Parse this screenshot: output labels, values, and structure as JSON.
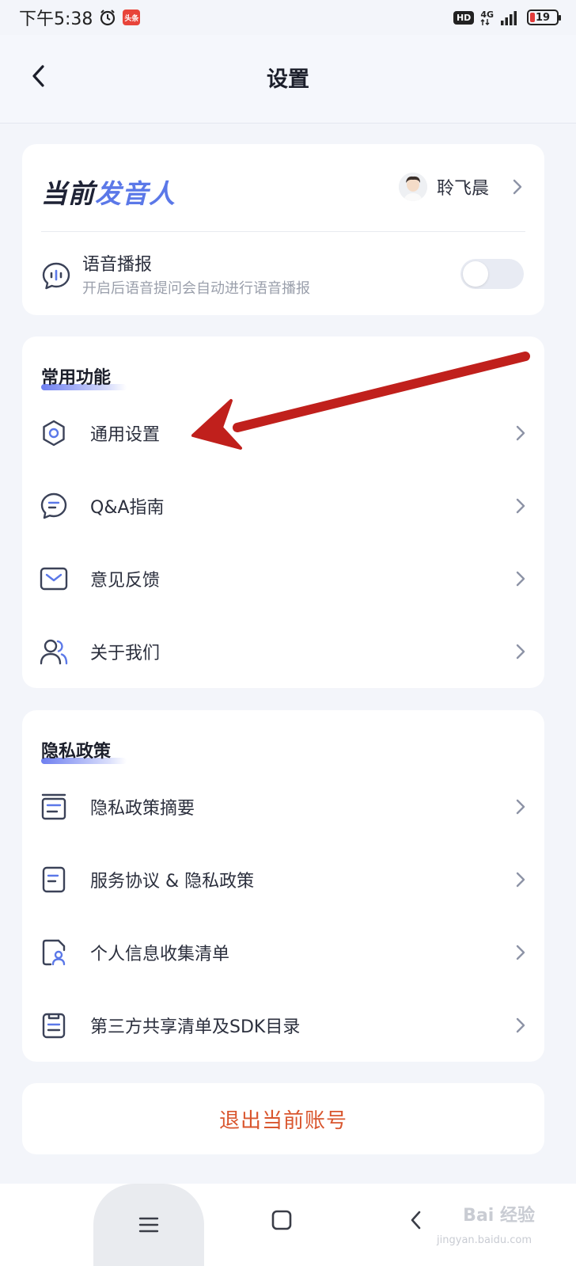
{
  "status_bar": {
    "time": "下午5:38",
    "hd": "HD",
    "network": "4G",
    "battery": "19",
    "app_badge": "头条"
  },
  "header": {
    "title": "设置",
    "back_icon": "chevron-left-icon"
  },
  "speaker": {
    "title_dark": "当前",
    "title_blue": "发音人",
    "name": "聆飞晨",
    "voice_title": "语音播报",
    "voice_subtitle": "开启后语音提问会自动进行语音播报",
    "voice_enabled": false
  },
  "common": {
    "section_title": "常用功能",
    "items": [
      {
        "label": "通用设置",
        "icon": "gear-icon"
      },
      {
        "label": "Q&A指南",
        "icon": "chat-bubble-icon"
      },
      {
        "label": "意见反馈",
        "icon": "mail-icon"
      },
      {
        "label": "关于我们",
        "icon": "users-icon"
      }
    ]
  },
  "privacy": {
    "section_title": "隐私政策",
    "items": [
      {
        "label": "隐私政策摘要",
        "icon": "summary-doc-icon"
      },
      {
        "label": "服务协议 & 隐私政策",
        "icon": "document-icon"
      },
      {
        "label": "个人信息收集清单",
        "icon": "personal-info-doc-icon"
      },
      {
        "label": "第三方共享清单及SDK目录",
        "icon": "clipboard-list-icon"
      }
    ]
  },
  "logout": {
    "label": "退出当前账号"
  },
  "watermark": {
    "text": "Bai 经验",
    "sub": "jingyan.baidu.com"
  },
  "colors": {
    "accent_blue": "#5b78e8",
    "logout_red": "#d9562e",
    "annotation_red": "#c0201c"
  }
}
